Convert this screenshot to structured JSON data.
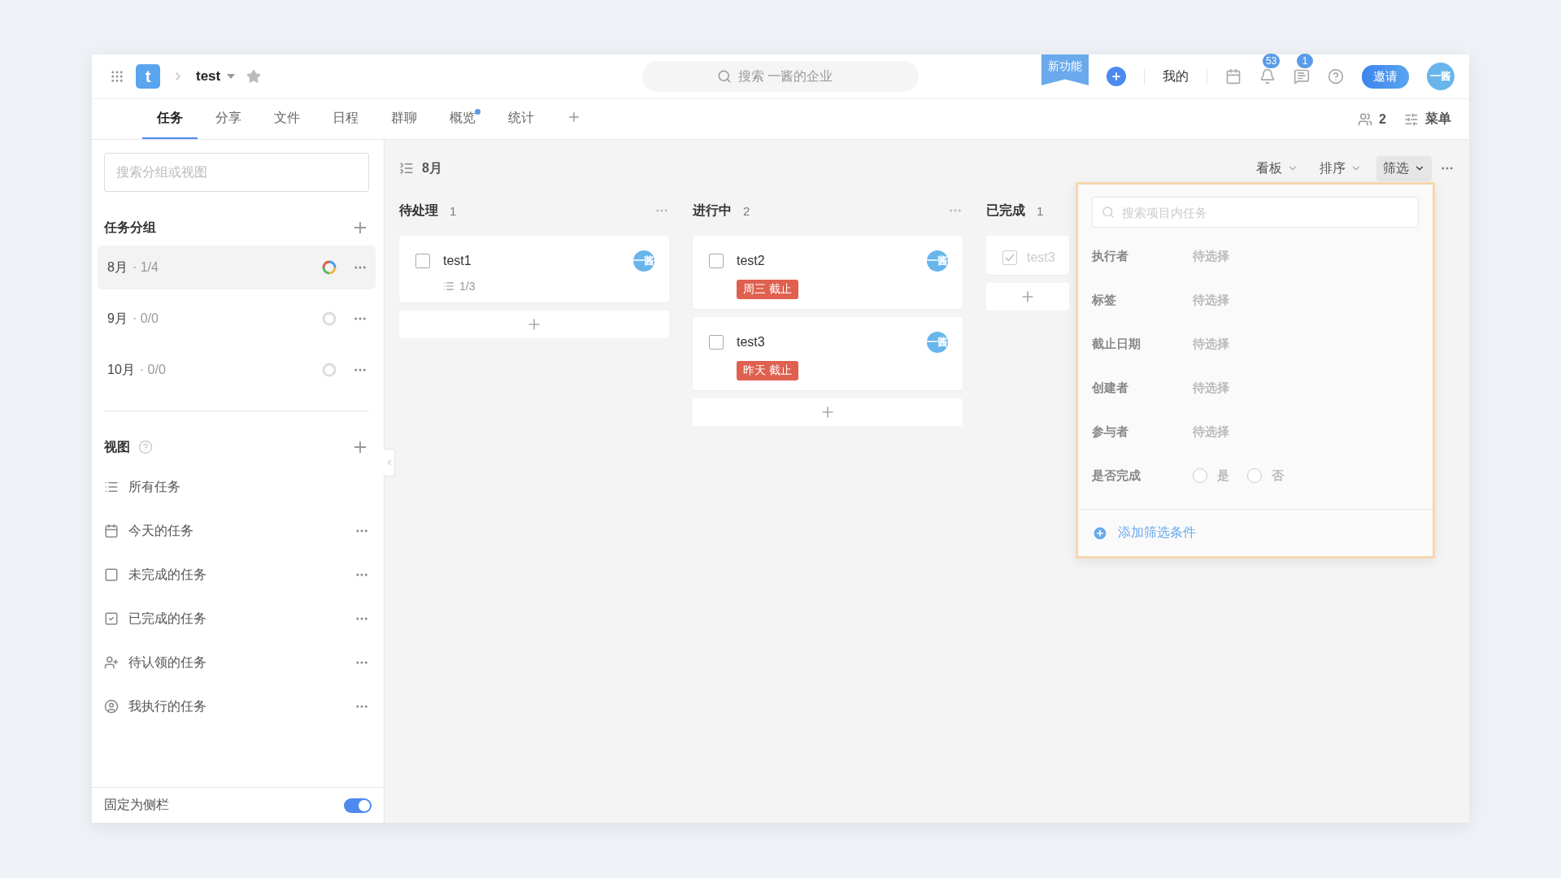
{
  "topbar": {
    "logo": "t",
    "project": "test",
    "new_feature": "新功能",
    "search": {
      "placeholder": "搜索 一酱的企业"
    },
    "mine": "我的",
    "notifications_badge": "53",
    "messages_badge": "1",
    "invite": "邀请",
    "avatar": "一酱"
  },
  "tabs": [
    {
      "label": "任务",
      "selected": true,
      "dot": false
    },
    {
      "label": "分享",
      "selected": false,
      "dot": false
    },
    {
      "label": "文件",
      "selected": false,
      "dot": false
    },
    {
      "label": "日程",
      "selected": false,
      "dot": false
    },
    {
      "label": "群聊",
      "selected": false,
      "dot": false
    },
    {
      "label": "概览",
      "selected": false,
      "dot": true
    },
    {
      "label": "统计",
      "selected": false,
      "dot": false
    }
  ],
  "members": "2",
  "menu": "菜单",
  "sidebar": {
    "search": {
      "placeholder": "搜索分组或视图"
    },
    "groups_title": "任务分组",
    "groups": [
      {
        "name": "8月",
        "progress": "· 1/4",
        "selected": true
      },
      {
        "name": "9月",
        "progress": "· 0/0",
        "selected": false
      },
      {
        "name": "10月",
        "progress": "· 0/0",
        "selected": false
      }
    ],
    "views_title": "视图",
    "views": [
      {
        "label": "所有任务"
      },
      {
        "label": "今天的任务"
      },
      {
        "label": "未完成的任务"
      },
      {
        "label": "已完成的任务"
      },
      {
        "label": "待认领的任务"
      },
      {
        "label": "我执行的任务"
      }
    ],
    "pin_label": "固定为侧栏",
    "pin_on": true
  },
  "board": {
    "title": "8月",
    "toolbar": [
      {
        "label": "看板",
        "selected": false
      },
      {
        "label": "排序",
        "selected": false
      },
      {
        "label": "筛选",
        "selected": true
      }
    ],
    "columns": [
      {
        "name": "待处理",
        "count": "1",
        "cards": [
          {
            "title": "test1",
            "checked": false,
            "avatar": "一酱",
            "subtasks": "1/3"
          }
        ]
      },
      {
        "name": "进行中",
        "count": "2",
        "cards": [
          {
            "title": "test2",
            "checked": false,
            "avatar": "一酱",
            "due": "周三 截止"
          },
          {
            "title": "test3",
            "checked": false,
            "avatar": "一酱",
            "due": "昨天 截止"
          }
        ]
      },
      {
        "name": "已完成",
        "count": "1",
        "cards": [
          {
            "title": "test3",
            "checked": true
          }
        ]
      }
    ]
  },
  "filter_panel": {
    "search": {
      "placeholder": "搜索项目内任务"
    },
    "rows": [
      {
        "kind": "select",
        "label": "执行者",
        "value": "待选择"
      },
      {
        "kind": "select",
        "label": "标签",
        "value": "待选择"
      },
      {
        "kind": "select",
        "label": "截止日期",
        "value": "待选择"
      },
      {
        "kind": "select",
        "label": "创建者",
        "value": "待选择"
      },
      {
        "kind": "select",
        "label": "参与者",
        "value": "待选择"
      },
      {
        "kind": "radio",
        "label": "是否完成",
        "options": [
          {
            "label": "是",
            "selected": false
          },
          {
            "label": "否",
            "selected": false
          }
        ]
      }
    ],
    "add_condition": "添加筛选条件"
  }
}
